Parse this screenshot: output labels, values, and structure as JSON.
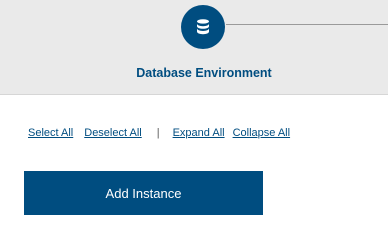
{
  "stepper": {
    "steps": [
      {
        "label": "Database Environment",
        "icon": "database-icon",
        "state": "active"
      }
    ]
  },
  "selection_links": {
    "select_all": "Select All",
    "deselect_all": "Deselect All",
    "separator": "|",
    "expand_all": "Expand All",
    "collapse_all": "Collapse All"
  },
  "actions": {
    "add_instance": "Add Instance"
  },
  "colors": {
    "primary": "#004d80",
    "stepper_background": "#eaeaea",
    "connector": "#9a9a9a",
    "separator_text": "#5a5a5a"
  }
}
